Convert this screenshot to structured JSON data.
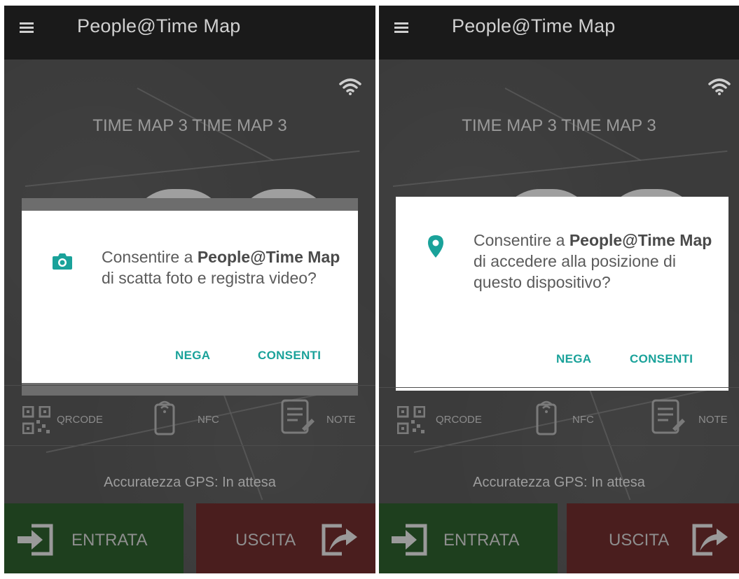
{
  "screens": [
    {
      "app_title": "People@Time Map",
      "device_name": "TIME MAP 3 TIME MAP 3",
      "dialog": {
        "icon": "camera-icon",
        "msg_prefix": "Consentire a ",
        "msg_app": "People@Time Map",
        "msg_suffix": " di scatta foto e registra video?",
        "deny_label": "NEGA",
        "allow_label": "CONSENTI"
      },
      "tools": {
        "qrcode_label": "QRCODE",
        "nfc_label": "NFC",
        "note_label": "NOTE"
      },
      "gps_status": "Accuratezza GPS: In attesa",
      "entrata_label": "ENTRATA",
      "uscita_label": "USCITA"
    },
    {
      "app_title": "People@Time Map",
      "device_name": "TIME MAP 3 TIME MAP 3",
      "dialog": {
        "icon": "location-pin-icon",
        "msg_prefix": "Consentire a ",
        "msg_app": "People@Time Map",
        "msg_suffix": " di accedere alla posizione di questo dispositivo?",
        "deny_label": "NEGA",
        "allow_label": "CONSENTI"
      },
      "tools": {
        "qrcode_label": "QRCODE",
        "nfc_label": "NFC",
        "note_label": "NOTE"
      },
      "gps_status": "Accuratezza GPS: In attesa",
      "entrata_label": "ENTRATA",
      "uscita_label": "USCITA"
    }
  ],
  "colors": {
    "accent": "#1aa29a",
    "appbar": "#1a1a1a",
    "entrata_bg": "#1e3f1e",
    "uscita_bg": "#4a1e1e"
  }
}
